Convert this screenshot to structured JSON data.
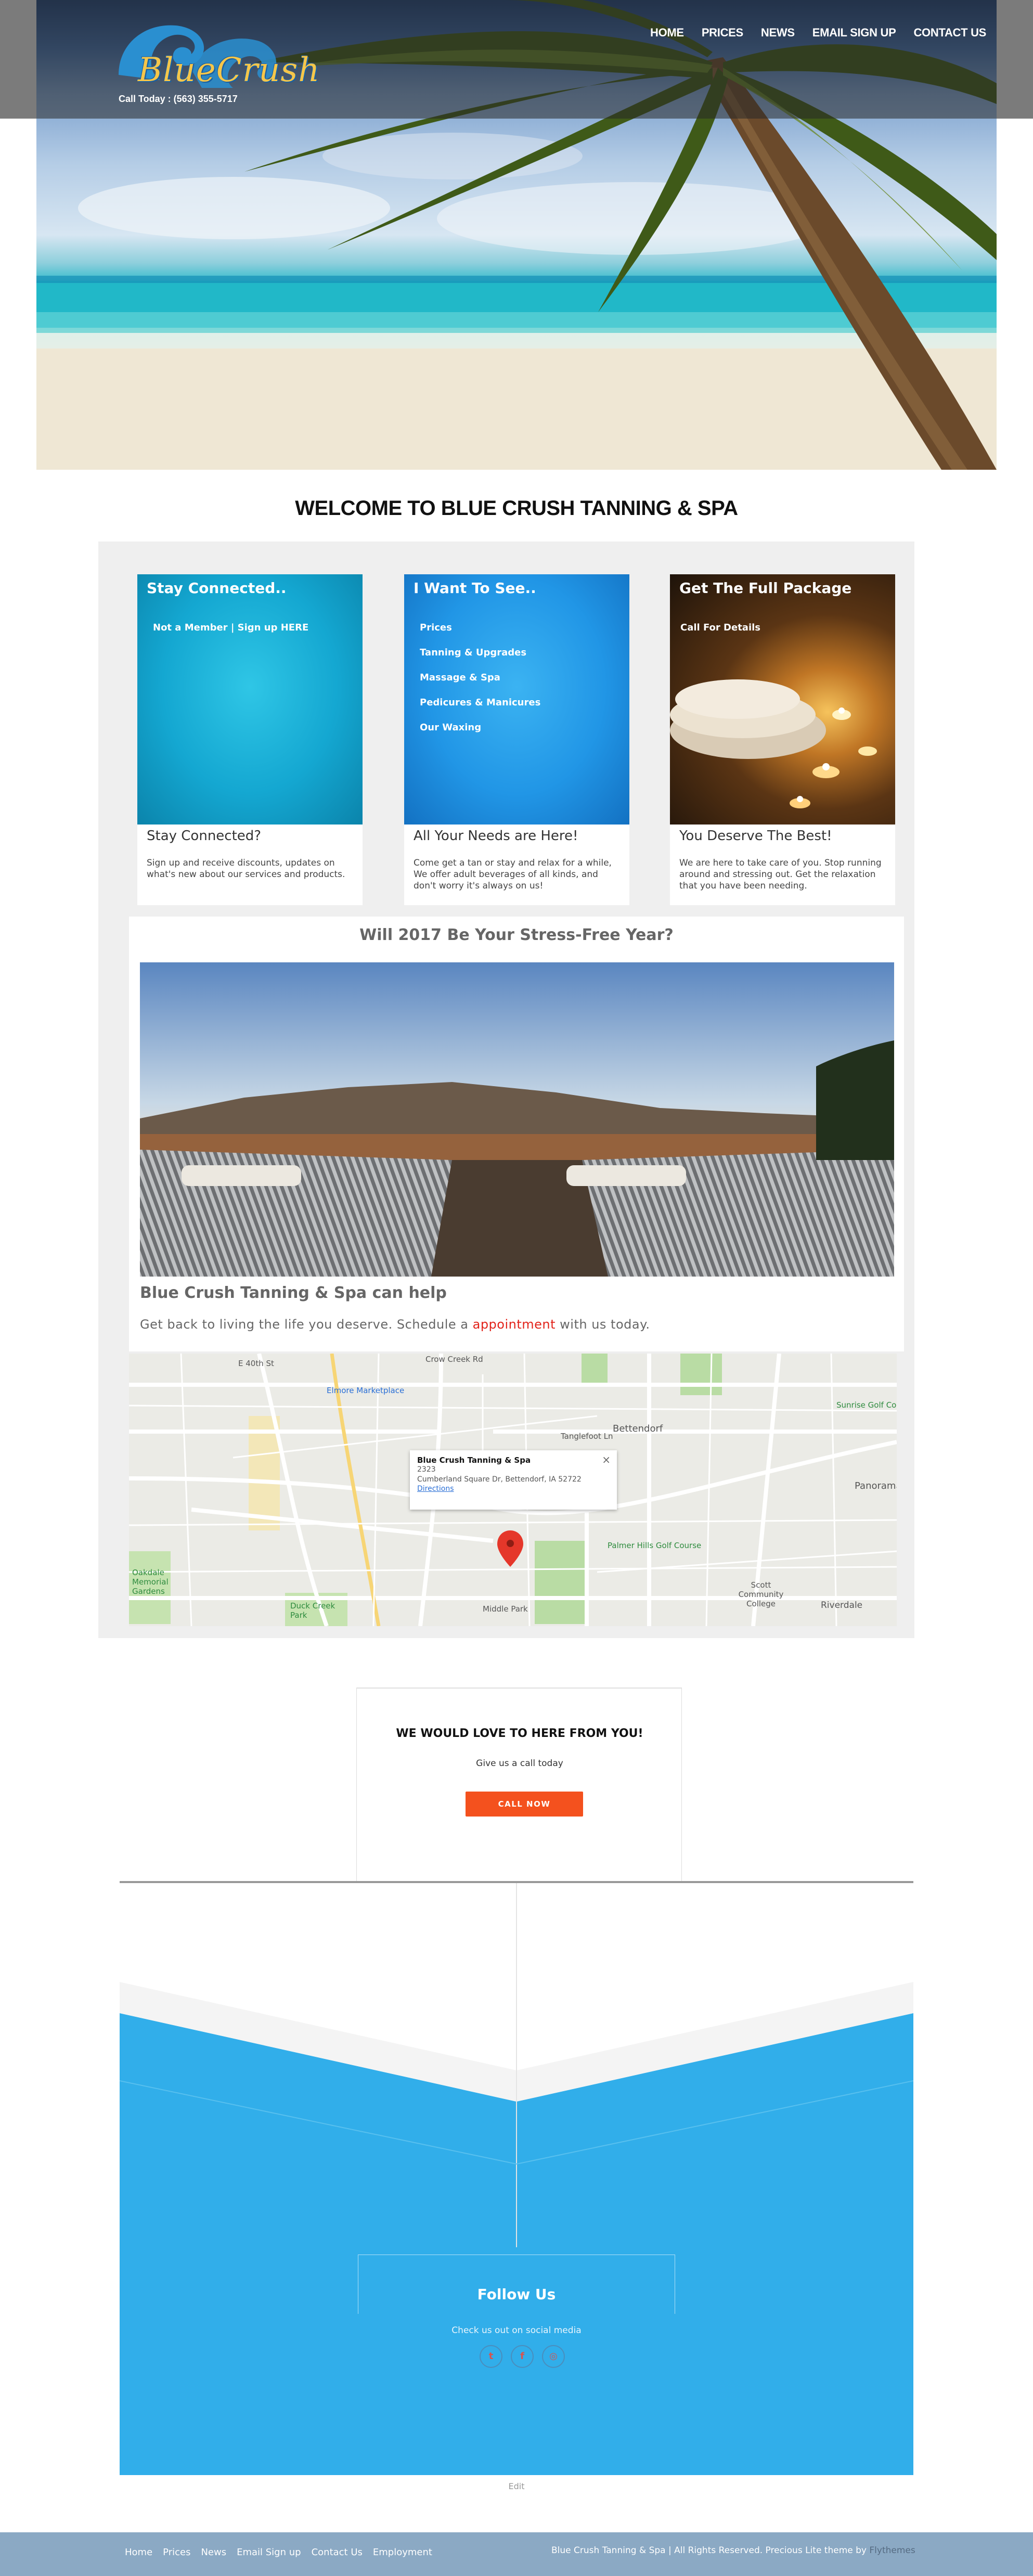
{
  "header": {
    "logo_text": "BlueCrush",
    "call_today": "Call Today : (563) 355-5717",
    "nav": [
      "HOME",
      "PRICES",
      "NEWS",
      "EMAIL SIGN UP",
      "CONTACT US"
    ]
  },
  "welcome": {
    "title": "WELCOME TO BLUE CRUSH TANNING & SPA"
  },
  "cards": [
    {
      "heading": "Stay Connected..",
      "links": [
        "Not a Member | Sign up HERE"
      ],
      "title": "Stay Connected?",
      "text": "Sign up and receive discounts, updates on what's new about our services and products."
    },
    {
      "heading": "I Want To See..",
      "links": [
        "Prices",
        "Tanning & Upgrades",
        "Massage & Spa",
        "Pedicures & Manicures",
        "Our Waxing"
      ],
      "title": "All Your Needs are Here!",
      "text": "Come get a tan or stay and relax for a while, We offer adult beverages of all kinds, and don't worry it's always on us!"
    },
    {
      "heading": "Get The Full Package",
      "links": [
        "Call For Details"
      ],
      "title": "You Deserve The Best!",
      "text": "We are here to take care of you. Stop running around and stressing out. Get the relaxation that you have been needing."
    }
  ],
  "stress": {
    "title": "Will 2017 Be Your Stress-Free Year?",
    "help_title": "Blue Crush Tanning & Spa can help",
    "help_text_before": "Get back to living the life you deserve. Schedule a ",
    "help_link": "appointment",
    "help_text_after": " with us today."
  },
  "map": {
    "popup_name": "Blue Crush Tanning & Spa",
    "popup_addr1": "2323",
    "popup_addr2": "Cumberland Square Dr, Bettendorf, IA 52722",
    "popup_directions": "Directions",
    "popup_close": "×",
    "labels": {
      "elmore": "Elmore Marketplace",
      "bettendorf": "Bettendorf",
      "sunrise": "Sunrise Golf Course",
      "panorama": "Panorama",
      "palmer": "Palmer Hills Golf Course",
      "oakdale": "Oakdale Memorial Gardens",
      "duck": "Duck Creek Park",
      "middle": "Middle Park",
      "scott": "Scott Community College",
      "riverdale": "Riverdale",
      "e40": "E 40th St",
      "crow": "Crow Creek Rd",
      "tanglefoot": "Tanglefoot Ln"
    }
  },
  "cta": {
    "title": "WE WOULD LOVE TO HERE FROM YOU!",
    "subtitle": "Give us a call today",
    "button": "CALL NOW"
  },
  "follow": {
    "title": "Follow Us",
    "subtitle": "Check us out on social media",
    "icons": [
      "twitter-icon",
      "facebook-icon",
      "instagram-icon"
    ],
    "edit": "Edit"
  },
  "footer": {
    "nav": [
      "Home",
      "Prices",
      "News",
      "Email Sign up",
      "Contact Us",
      "Employment"
    ],
    "copyright": "Blue Crush Tanning & Spa | All Rights Reserved. Precious Lite theme by ",
    "credit": "Flythemes"
  },
  "colors": {
    "accent_blue": "#31aeea",
    "cta_orange": "#f4511e",
    "footer_bg": "#8ba9c4",
    "link_red": "#e2231a"
  }
}
